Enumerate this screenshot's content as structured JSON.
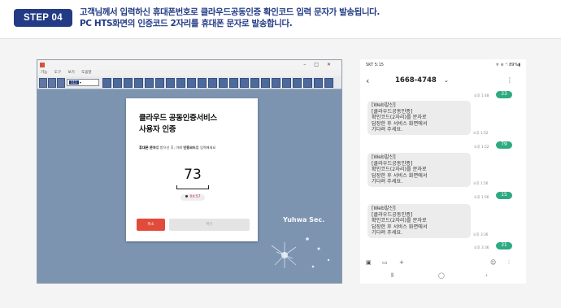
{
  "header": {
    "step_label": "STEP 04",
    "line1": "고객님께서 입력하신 휴대폰번호로 클라우드공동인증 확인코드 입력 문자가 발송됩니다.",
    "line2": "PC HTS화면의 인증코드 2자리를 휴대폰 문자로 발송합니다."
  },
  "hts": {
    "menu": [
      "기능",
      "도구",
      "보기",
      "도움말"
    ],
    "dropdown_code": "111",
    "watermark": "Yuhwa Sec."
  },
  "auth": {
    "title_line1": "클라우드 공동인증서비스",
    "title_line2": "사용자 인증",
    "desc_bold1": "휴대폰 문자",
    "desc_mid": "를 받으신 후, 아래 ",
    "desc_bold2": "인증코드",
    "desc_end": "를 입력해세요",
    "code": "73",
    "timer": "04:57",
    "cancel_label": "취소",
    "confirm_label": "확인"
  },
  "phone": {
    "status_time": "SKT 5:15",
    "status_right": "ᯤ ≋ ᐩ⫶ 89%▮",
    "contact": "1668-4748",
    "messages": [
      {
        "type": "sent",
        "text": "33",
        "time": "오후 1:48"
      },
      {
        "type": "recv",
        "lines": [
          "[Web발신]",
          "[클라우드공동인증]",
          "확인코드(2자리)를 문자로",
          "답장한 후 서비스 화면에서",
          "기다려 주세요."
        ],
        "time": "오후 1:52"
      },
      {
        "type": "sent",
        "text": "79",
        "time": "오후 1:52"
      },
      {
        "type": "recv",
        "lines": [
          "[Web발신]",
          "[클라우드공동인증]",
          "확인코드(2자리)를 문자로",
          "답장한 후 서비스 화면에서",
          "기다려 주세요."
        ],
        "time": "오후 1:56"
      },
      {
        "type": "sent",
        "text": "15",
        "time": "오후 1:56"
      },
      {
        "type": "recv",
        "lines": [
          "[Web발신]",
          "[클라우드공동인증]",
          "확인코드(2자리)를 문자로",
          "답장한 후 서비스 화면에서",
          "기다려 주세요."
        ],
        "time": "오후 3:36"
      },
      {
        "type": "sent",
        "text": "31",
        "time": "오후 3:36"
      }
    ],
    "accent": "#2eaa82"
  }
}
